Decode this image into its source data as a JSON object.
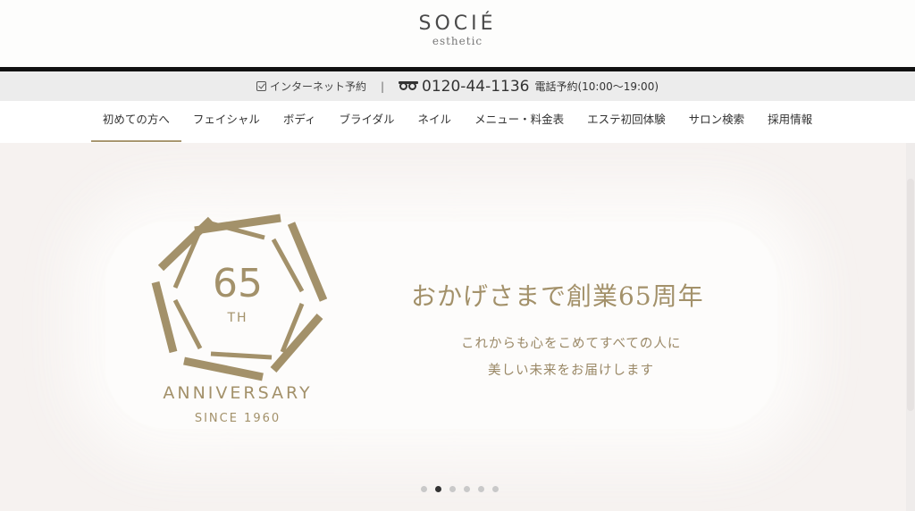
{
  "logo": {
    "name": "SOCIÉ",
    "sub": "esthetic"
  },
  "infobar": {
    "internet_label": "インターネット予約",
    "separator": "|",
    "phone": "0120-44-1136",
    "phone_note": "電話予約(10:00～19:00)"
  },
  "nav": {
    "items": [
      {
        "label": "初めての方へ"
      },
      {
        "label": "フェイシャル"
      },
      {
        "label": "ボディ"
      },
      {
        "label": "ブライダル"
      },
      {
        "label": "ネイル"
      },
      {
        "label": "メニュー・料金表"
      },
      {
        "label": "エステ初回体験"
      },
      {
        "label": "サロン検索"
      },
      {
        "label": "採用情報"
      }
    ],
    "active_index": 0
  },
  "hero": {
    "badge_number": "65",
    "badge_suffix": "TH",
    "badge_title": "ANNIVERSARY",
    "badge_since": "SINCE 1960",
    "tagline": "おかげさまで創業65周年",
    "sub_line1": "これからも心をこめてすべての人に",
    "sub_line2": "美しい未来をお届けします",
    "slide_count": 6,
    "active_slide": 1
  },
  "colors": {
    "accent": "#a99770",
    "gold": "#a3916a",
    "hero_bg": "#f6f2f0"
  }
}
